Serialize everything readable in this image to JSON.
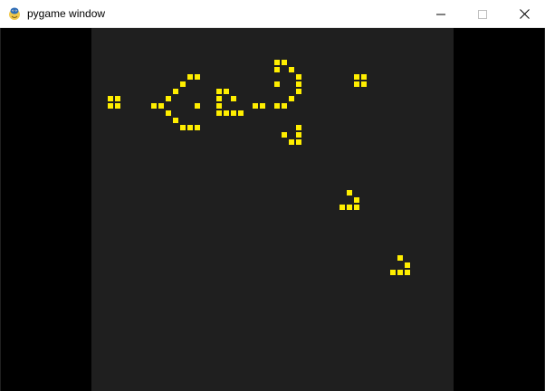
{
  "window": {
    "title": "pygame window",
    "icon": "pygame-snake-icon",
    "controls": [
      {
        "name": "minimize-button",
        "icon": "minimize-icon"
      },
      {
        "name": "maximize-button",
        "icon": "maximize-icon"
      },
      {
        "name": "close-button",
        "icon": "close-icon"
      }
    ]
  },
  "colors": {
    "board_background": "#1f1f1f",
    "outside_background": "#000000",
    "live_cell": "#ffee00",
    "titlebar": "#ffffff"
  },
  "game": {
    "type": "conway-game-of-life",
    "grid_cell_size_units": 1,
    "live_cells": [
      [
        1,
        9
      ],
      [
        2,
        9
      ],
      [
        1,
        10
      ],
      [
        2,
        10
      ],
      [
        7,
        10
      ],
      [
        8,
        10
      ],
      [
        9,
        9
      ],
      [
        9,
        11
      ],
      [
        10,
        8
      ],
      [
        10,
        12
      ],
      [
        11,
        7
      ],
      [
        11,
        13
      ],
      [
        12,
        6
      ],
      [
        12,
        13
      ],
      [
        13,
        6
      ],
      [
        13,
        10
      ],
      [
        13,
        13
      ],
      [
        16,
        8
      ],
      [
        16,
        9
      ],
      [
        16,
        10
      ],
      [
        16,
        11
      ],
      [
        17,
        8
      ],
      [
        17,
        11
      ],
      [
        18,
        9
      ],
      [
        18,
        11
      ],
      [
        19,
        11
      ],
      [
        21,
        10
      ],
      [
        22,
        10
      ],
      [
        24,
        4
      ],
      [
        24,
        5
      ],
      [
        24,
        7
      ],
      [
        24,
        10
      ],
      [
        25,
        4
      ],
      [
        25,
        10
      ],
      [
        26,
        5
      ],
      [
        26,
        9
      ],
      [
        27,
        6
      ],
      [
        27,
        7
      ],
      [
        27,
        8
      ],
      [
        25,
        14
      ],
      [
        26,
        15
      ],
      [
        27,
        13
      ],
      [
        27,
        14
      ],
      [
        27,
        15
      ],
      [
        35,
        6
      ],
      [
        36,
        6
      ],
      [
        35,
        7
      ],
      [
        36,
        7
      ],
      [
        34,
        22
      ],
      [
        35,
        23
      ],
      [
        33,
        24
      ],
      [
        34,
        24
      ],
      [
        35,
        24
      ],
      [
        41,
        31
      ],
      [
        42,
        32
      ],
      [
        40,
        33
      ],
      [
        41,
        33
      ],
      [
        42,
        33
      ]
    ]
  }
}
